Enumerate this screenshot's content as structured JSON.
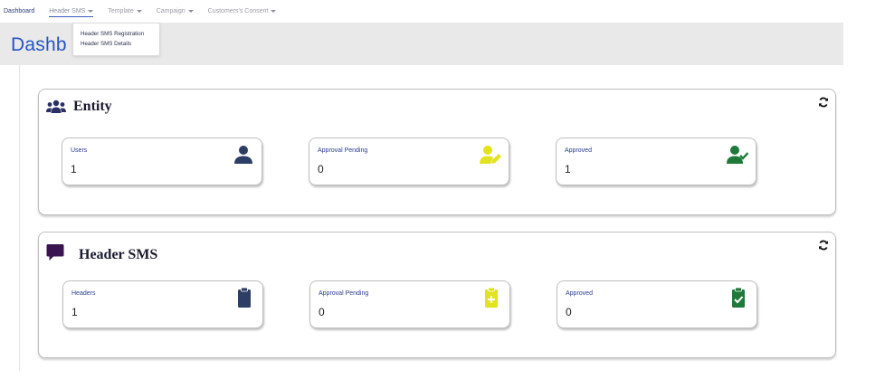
{
  "nav": {
    "dashboard": "Dashboard",
    "header_sms": "Header SMS",
    "template": "Template",
    "campaign": "Campaign",
    "consent": "Customers's Consent"
  },
  "dropdown": {
    "items": [
      "Header SMS Registration",
      "Header SMS Details"
    ]
  },
  "page": {
    "title": "Dashb"
  },
  "entity": {
    "title": "Entity",
    "cards": [
      {
        "label": "Users",
        "value": "1",
        "icon": "user-icon",
        "color": "#2c3e63"
      },
      {
        "label": "Approval Pending",
        "value": "0",
        "icon": "user-edit-icon",
        "color": "#e2e21e"
      },
      {
        "label": "Approved",
        "value": "1",
        "icon": "user-check-icon",
        "color": "#1f7a3a"
      }
    ]
  },
  "header_sms": {
    "title": "Header SMS",
    "cards": [
      {
        "label": "Headers",
        "value": "1",
        "icon": "clipboard-icon",
        "color": "#2c3e63"
      },
      {
        "label": "Approval Pending",
        "value": "0",
        "icon": "clipboard-plus-icon",
        "color": "#e2e21e"
      },
      {
        "label": "Approved",
        "value": "0",
        "icon": "clipboard-check-icon",
        "color": "#1f7a3a"
      }
    ]
  },
  "colors": {
    "title_blue": "#2554c7",
    "entity_icon": "#2a2f66",
    "sms_icon": "#3a1450"
  }
}
